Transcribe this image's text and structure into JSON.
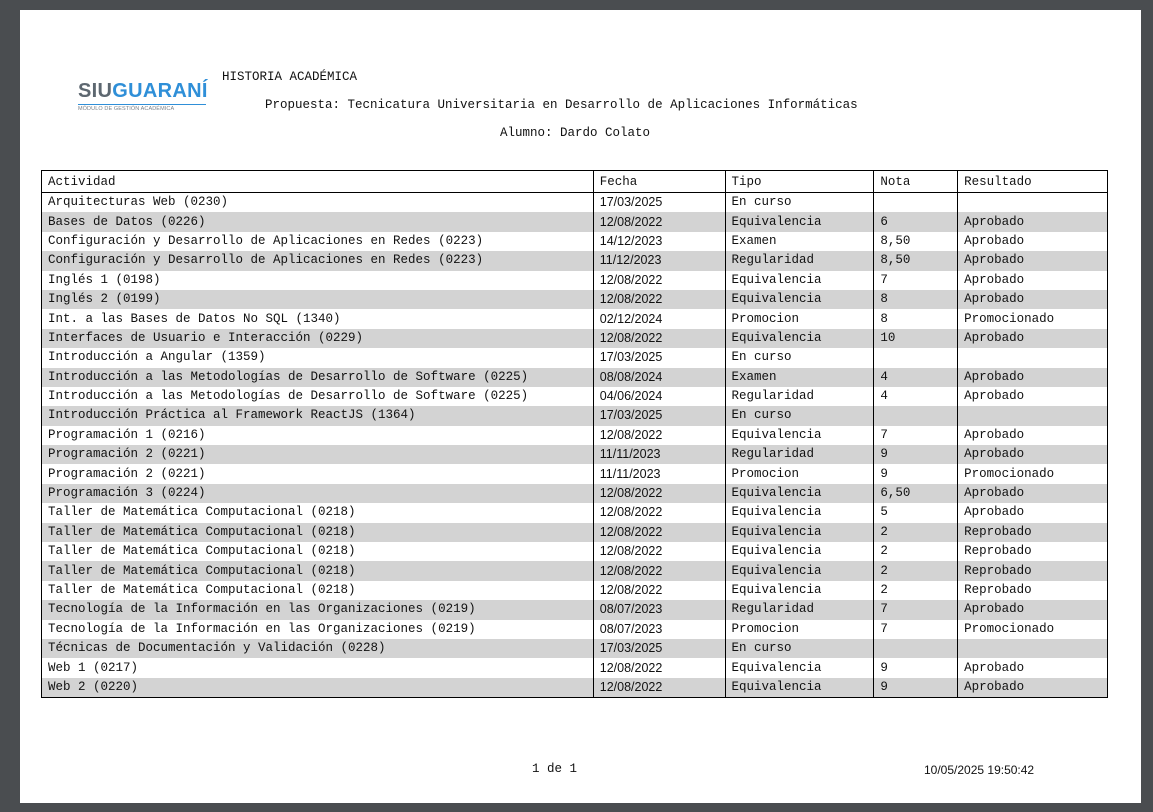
{
  "logo": {
    "part1": "SIU",
    "part2": "GUARANÍ",
    "subtitle": "MÓDULO DE GESTIÓN ACADÉMICA"
  },
  "header": {
    "title": "HISTORIA ACADÉMICA",
    "propuesta": "Propuesta: Tecnicatura Universitaria en Desarrollo de Aplicaciones Informáticas",
    "alumno": "Alumno: Dardo Colato"
  },
  "table": {
    "columns": [
      "Actividad",
      "Fecha",
      "Tipo",
      "Nota",
      "Resultado"
    ],
    "rows": [
      [
        "Arquitecturas Web (0230)",
        "17/03/2025",
        "En curso",
        "",
        ""
      ],
      [
        "Bases de Datos (0226)",
        "12/08/2022",
        "Equivalencia",
        "6",
        "Aprobado"
      ],
      [
        "Configuración y Desarrollo de Aplicaciones en Redes (0223)",
        "14/12/2023",
        "Examen",
        "8,50",
        "Aprobado"
      ],
      [
        "Configuración y Desarrollo de Aplicaciones en Redes (0223)",
        "11/12/2023",
        "Regularidad",
        "8,50",
        "Aprobado"
      ],
      [
        "Inglés 1 (0198)",
        "12/08/2022",
        "Equivalencia",
        "7",
        "Aprobado"
      ],
      [
        "Inglés 2 (0199)",
        "12/08/2022",
        "Equivalencia",
        "8",
        "Aprobado"
      ],
      [
        "Int. a las Bases de Datos No SQL (1340)",
        "02/12/2024",
        "Promocion",
        "8",
        "Promocionado"
      ],
      [
        "Interfaces de Usuario e Interacción (0229)",
        "12/08/2022",
        "Equivalencia",
        "10",
        "Aprobado"
      ],
      [
        "Introducción a Angular (1359)",
        "17/03/2025",
        "En curso",
        "",
        ""
      ],
      [
        "Introducción a las Metodologías de Desarrollo de Software (0225)",
        "08/08/2024",
        "Examen",
        "4",
        "Aprobado"
      ],
      [
        "Introducción a las Metodologías de Desarrollo de Software (0225)",
        "04/06/2024",
        "Regularidad",
        "4",
        "Aprobado"
      ],
      [
        "Introducción Práctica al Framework ReactJS (1364)",
        "17/03/2025",
        "En curso",
        "",
        ""
      ],
      [
        "Programación 1 (0216)",
        "12/08/2022",
        "Equivalencia",
        "7",
        "Aprobado"
      ],
      [
        "Programación 2 (0221)",
        "11/11/2023",
        "Regularidad",
        "9",
        "Aprobado"
      ],
      [
        "Programación 2 (0221)",
        "11/11/2023",
        "Promocion",
        "9",
        "Promocionado"
      ],
      [
        "Programación 3 (0224)",
        "12/08/2022",
        "Equivalencia",
        "6,50",
        "Aprobado"
      ],
      [
        "Taller de Matemática Computacional (0218)",
        "12/08/2022",
        "Equivalencia",
        "5",
        "Aprobado"
      ],
      [
        "Taller de Matemática Computacional (0218)",
        "12/08/2022",
        "Equivalencia",
        "2",
        "Reprobado"
      ],
      [
        "Taller de Matemática Computacional (0218)",
        "12/08/2022",
        "Equivalencia",
        "2",
        "Reprobado"
      ],
      [
        "Taller de Matemática Computacional (0218)",
        "12/08/2022",
        "Equivalencia",
        "2",
        "Reprobado"
      ],
      [
        "Taller de Matemática Computacional (0218)",
        "12/08/2022",
        "Equivalencia",
        "2",
        "Reprobado"
      ],
      [
        "Tecnología de la Información en las Organizaciones (0219)",
        "08/07/2023",
        "Regularidad",
        "7",
        "Aprobado"
      ],
      [
        "Tecnología de la Información en las Organizaciones (0219)",
        "08/07/2023",
        "Promocion",
        "7",
        "Promocionado"
      ],
      [
        "Técnicas de Documentación y Validación (0228)",
        "17/03/2025",
        "En curso",
        "",
        ""
      ],
      [
        "Web 1 (0217)",
        "12/08/2022",
        "Equivalencia",
        "9",
        "Aprobado"
      ],
      [
        "Web 2 (0220)",
        "12/08/2022",
        "Equivalencia",
        "9",
        "Aprobado"
      ]
    ]
  },
  "footer": {
    "page": "1 de 1",
    "datetime": "10/05/2025 19:50:42"
  },
  "colors": {
    "row_shade": "#d3d3d3",
    "logo_accent": "#2f8fd8",
    "logo_gray": "#5d6770",
    "viewer_bg": "#4a4d50"
  }
}
